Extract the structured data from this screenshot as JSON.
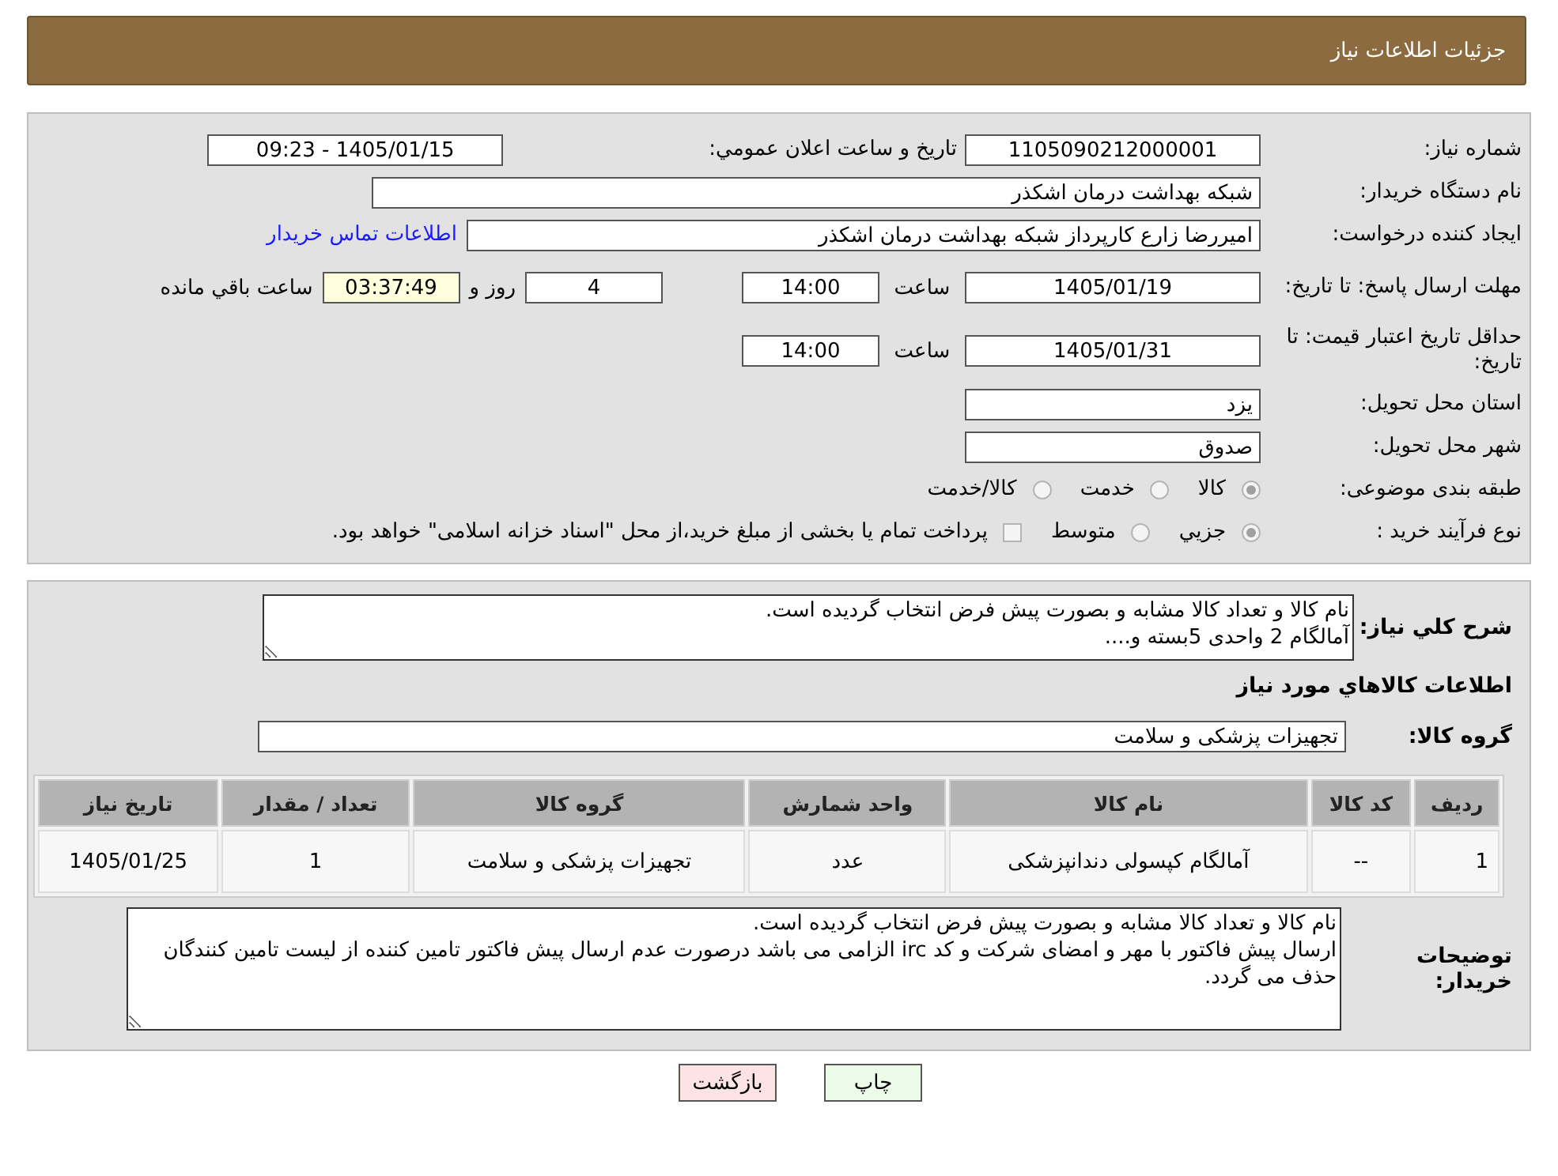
{
  "header": {
    "title": "جزئیات اطلاعات نیاز"
  },
  "need_number": {
    "label": "شماره نیاز:",
    "value": "1105090212000001"
  },
  "announce": {
    "label": "تاریخ و ساعت اعلان عمومي:",
    "value": "1405/01/15 - 09:23"
  },
  "buyer_org": {
    "label": "نام دستگاه خریدار:",
    "value": "شبکه بهداشت درمان اشکذر"
  },
  "requester": {
    "label": "ایجاد کننده درخواست:",
    "value": "امیررضا زارع کارپرداز شبکه بهداشت درمان اشکذر",
    "link": "اطلاعات تماس خریدار"
  },
  "reply_deadline": {
    "label": "مهلت ارسال پاسخ: تا تاریخ:",
    "date": "1405/01/19",
    "time_label": "ساعت",
    "time": "14:00",
    "days": "4",
    "days_suffix": "روز و",
    "remaining": "03:37:49",
    "remaining_suffix": "ساعت باقي مانده"
  },
  "validity": {
    "label": "حداقل تاریخ اعتبار قیمت: تا تاریخ:",
    "date": "1405/01/31",
    "time_label": "ساعت",
    "time": "14:00"
  },
  "province": {
    "label": "استان محل تحویل:",
    "value": "یزد"
  },
  "city": {
    "label": "شهر محل تحویل:",
    "value": "صدوق"
  },
  "category": {
    "label": "طبقه بندی موضوعی:",
    "options": [
      {
        "label": "كالا",
        "selected": true
      },
      {
        "label": "خدمت",
        "selected": false
      },
      {
        "label": "كالا/خدمت",
        "selected": false
      }
    ]
  },
  "process": {
    "label": "نوع فرآیند خرید :",
    "options": [
      {
        "label": "جزيي",
        "selected": true
      },
      {
        "label": "متوسط",
        "selected": false
      }
    ],
    "payment": {
      "label": "پرداخت تمام یا بخشی از مبلغ خرید،از محل \"اسناد خزانه اسلامی\" خواهد بود.",
      "checked": false
    }
  },
  "description": {
    "label": "شرح كلي نياز:",
    "value": "نام کالا و تعداد کالا مشابه و بصورت پیش فرض انتخاب گردیده است.\nآمالگام 2 واحدی 5بسته و...."
  },
  "goods_title": "اطلاعات كالاهاي مورد نياز",
  "goods_group": {
    "label": "گروه کالا:",
    "value": "تجهیزات پزشکی و سلامت"
  },
  "table": {
    "columns": [
      "رديف",
      "کد کالا",
      "نام کالا",
      "واحد شمارش",
      "گروه کالا",
      "تعداد / مقدار",
      "تاریخ نیاز"
    ],
    "rows": [
      [
        "1",
        "--",
        "آمالگام کپسولی دندانپزشکی",
        "عدد",
        "تجهیزات پزشکی و سلامت",
        "1",
        "1405/01/25"
      ]
    ]
  },
  "buyer_notes": {
    "label": "توضیحات خریدار:",
    "value": "نام کالا و تعداد کالا مشابه و بصورت پیش فرض انتخاب گردیده است.\nارسال پیش فاکتور با مهر و امضای شرکت و کد irc الزامی می باشد درصورت عدم ارسال پیش فاکتور تامین کننده از لیست تامین کنندگان حذف می گردد."
  },
  "buttons": [
    {
      "label": "چاپ",
      "kind": "print"
    },
    {
      "label": "بازگشت",
      "kind": "back"
    }
  ]
}
